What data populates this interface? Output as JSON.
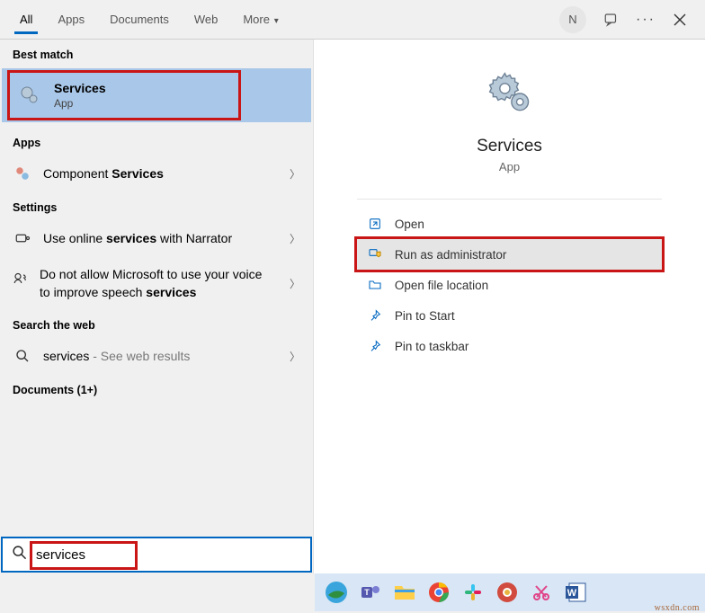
{
  "tabs": {
    "all": "All",
    "apps": "Apps",
    "documents": "Documents",
    "web": "Web",
    "more": "More"
  },
  "user_initial": "N",
  "sections": {
    "best_match": "Best match",
    "apps": "Apps",
    "settings": "Settings",
    "search_web": "Search the web",
    "documents": "Documents (1+)"
  },
  "best": {
    "title": "Services",
    "subtitle": "App"
  },
  "apps_row": {
    "prefix": "Component ",
    "bold": "Services"
  },
  "settings_rows": {
    "row1_pre": "Use online ",
    "row1_bold": "services",
    "row1_post": " with Narrator",
    "row2_pre": "Do not allow Microsoft to use your voice to improve speech ",
    "row2_bold": "services"
  },
  "web_row": {
    "term": "services",
    "suffix": " - See web results"
  },
  "preview": {
    "title": "Services",
    "subtitle": "App"
  },
  "actions": {
    "open": "Open",
    "run_admin": "Run as administrator",
    "open_loc": "Open file location",
    "pin_start": "Pin to Start",
    "pin_taskbar": "Pin to taskbar"
  },
  "search": {
    "value": "services"
  },
  "watermark": "wsxdn.com"
}
